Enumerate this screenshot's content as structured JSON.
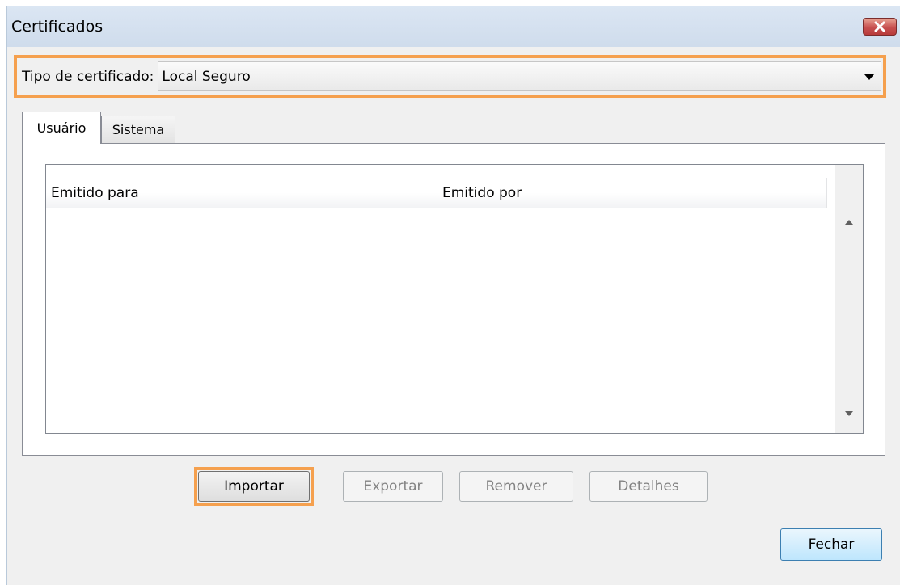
{
  "window": {
    "title": "Certificados"
  },
  "certificate_type": {
    "label": "Tipo de certificado:",
    "selected": "Local Seguro"
  },
  "tabs": [
    {
      "label": "Usuário",
      "active": true
    },
    {
      "label": "Sistema",
      "active": false
    }
  ],
  "list": {
    "columns": [
      "Emitido para",
      "Emitido por"
    ],
    "rows": []
  },
  "actions": {
    "import": "Importar",
    "export": "Exportar",
    "remove": "Remover",
    "details": "Detalhes",
    "close": "Fechar"
  },
  "colors": {
    "highlight": "#f5a04e",
    "titlebar": "#d5e1ef",
    "close_button": "#c75050"
  }
}
